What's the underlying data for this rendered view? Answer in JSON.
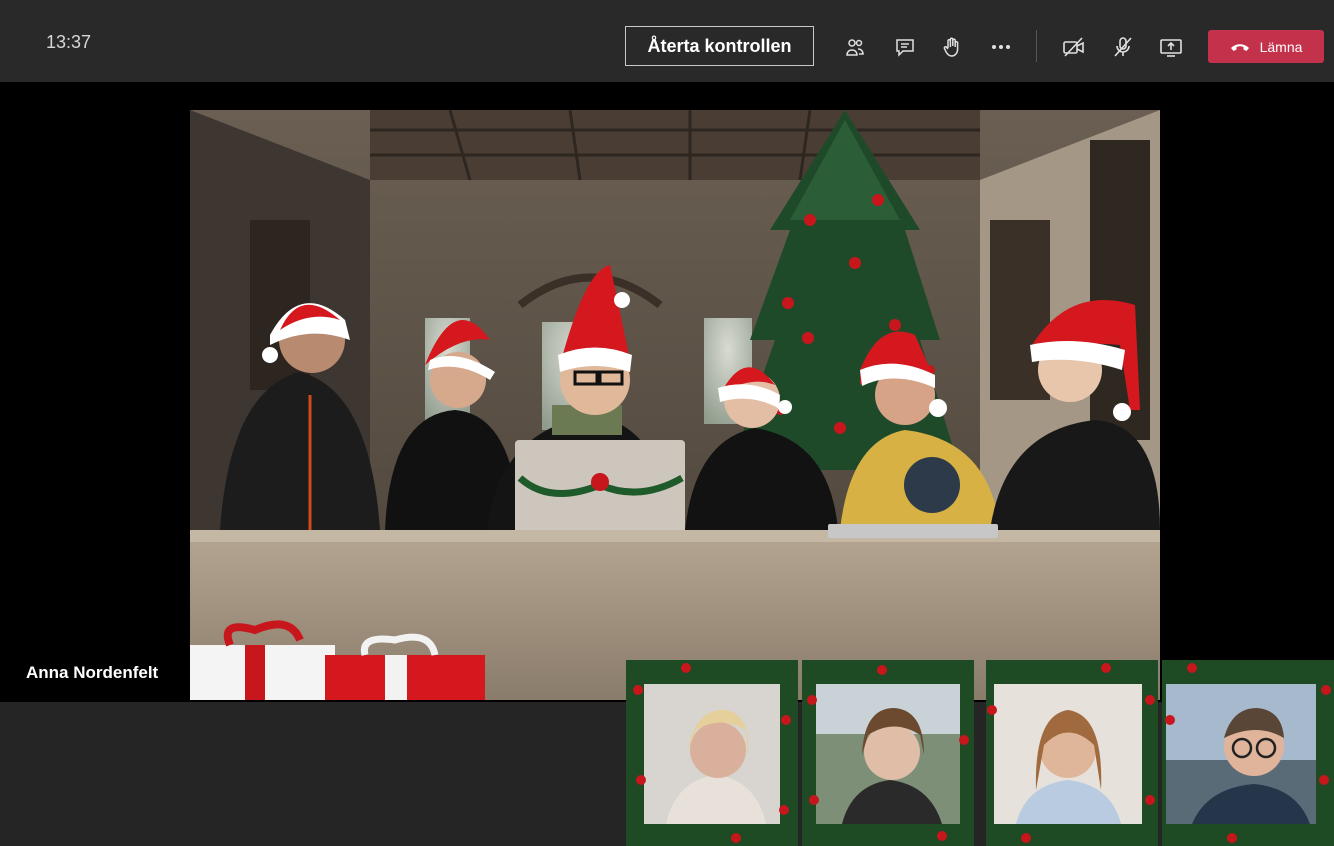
{
  "topbar": {
    "time": "13:37",
    "control_label": "Återta kontrollen",
    "icons": [
      "participants-icon",
      "chat-icon",
      "raise-hand-icon",
      "more-icon",
      "camera-off-icon",
      "mic-off-icon",
      "share-screen-icon"
    ],
    "leave_label": "Lämna",
    "leave_color": "#c4314b"
  },
  "stage": {
    "speaker_name": "Anna Nordenfelt"
  },
  "participants_count": 4
}
